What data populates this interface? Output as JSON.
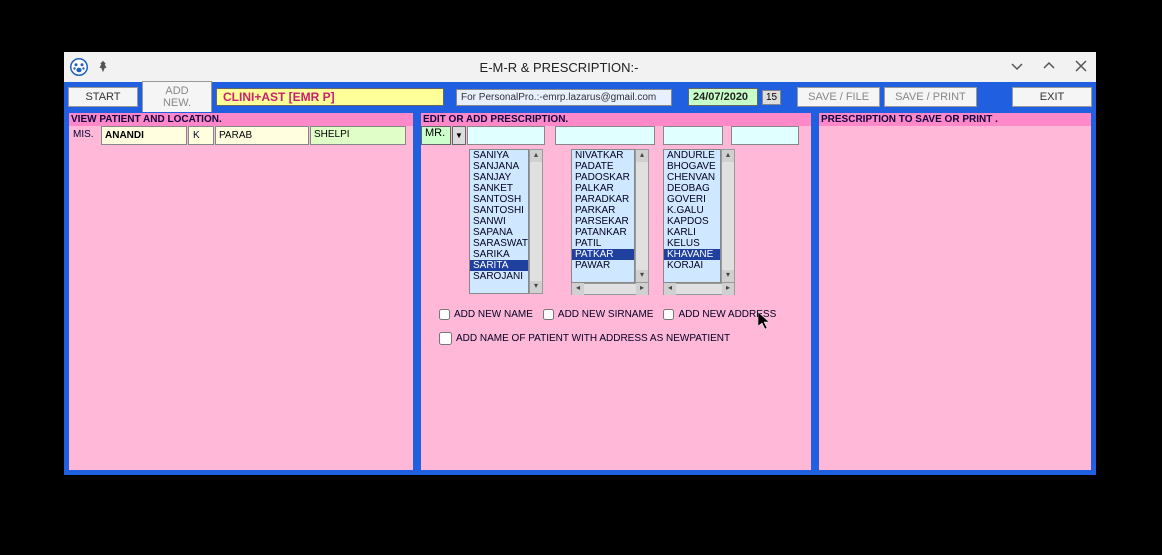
{
  "window": {
    "title": "E-M-R & PRESCRIPTION:-"
  },
  "toolbar": {
    "start": "START",
    "addnew": "ADD NEW.",
    "brand": "CLINI+AST [EMR P]",
    "personal": "For PersonalPro.:-emrp.lazarus@gmail.com",
    "date": "24/07/2020",
    "day": "15",
    "savefile": "SAVE / FILE",
    "saveprint": "SAVE / PRINT",
    "exit": "EXIT"
  },
  "patient": {
    "header": "  VIEW PATIENT AND LOCATION.",
    "title": "MIS.",
    "name": "ANANDI",
    "mid": "K",
    "surname": "PARAB",
    "location": "SHELPI"
  },
  "edit": {
    "header": "  EDIT OR ADD PRESCRIPTION.",
    "title": "MR.",
    "list1": [
      "SANIYA",
      "SANJANA",
      "SANJAY",
      "SANKET",
      "SANTOSH",
      "SANTOSHI",
      "SANWI",
      "SAPANA",
      "SARASWAT",
      "SARIKA",
      "SARITA",
      "SAROJANI"
    ],
    "list1sel": 10,
    "list2": [
      "NIVATKAR",
      "PADATE",
      "PADOSKAR",
      "PALKAR",
      "PARADKAR",
      "PARKAR",
      "PARSEKAR",
      "PATANKAR",
      "PATIL",
      "PATKAR",
      "PAWAR"
    ],
    "list2sel": 9,
    "list3": [
      "ANDURLE",
      "BHOGAVE",
      "CHENVAN",
      "DEOBAG",
      "GOVERI",
      "K.GALU",
      "KAPDOS",
      "KARLI",
      "KELUS",
      "KHAVANE",
      "KORJAI"
    ],
    "list3sel": 9,
    "cb1": "ADD  NEW NAME",
    "cb2": "ADD NEW SIRNAME",
    "cb3": "ADD NEW ADDRESS",
    "cb4": "ADD NAME OF PATIENT WITH ADDRESS   AS NEWPATIENT"
  },
  "print": {
    "header": "  PRESCRIPTION TO SAVE OR PRINT ."
  }
}
